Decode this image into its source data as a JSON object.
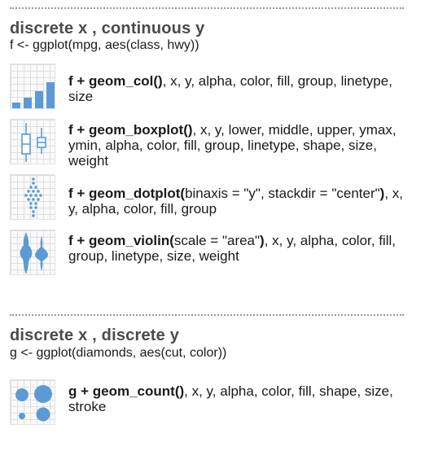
{
  "section1": {
    "title": "discrete x , continuous y",
    "code": "f <- ggplot(mpg, aes(class, hwy))",
    "rows": [
      {
        "icon": "bar-chart-icon",
        "fn": "f + geom_col()",
        "args": ", x, y, alpha, color, fill, group, linetype, size"
      },
      {
        "icon": "boxplot-icon",
        "fn": "f + geom_boxplot()",
        "args": ", x, y, lower, middle, upper, ymax, ymin, alpha, color, fill, group, linetype, shape, size, weight"
      },
      {
        "icon": "dotplot-icon",
        "fn": "f + geom_dotplot(",
        "mid": "binaxis = \"y\", stackdir = \"center\"",
        "fn_close": ")",
        "args": ", x, y, alpha, color, fill, group"
      },
      {
        "icon": "violin-icon",
        "fn": "f + geom_violin(",
        "mid": "scale = \"area\"",
        "fn_close": ")",
        "args": ", x, y, alpha, color, fill, group, linetype, size, weight"
      }
    ]
  },
  "section2": {
    "title": "discrete x , discrete y",
    "code": "g <- ggplot(diamonds, aes(cut, color))",
    "rows": [
      {
        "icon": "count-icon",
        "fn": "g + geom_count()",
        "args": ", x, y, alpha, color, fill, shape, size, stroke"
      }
    ]
  },
  "colors": {
    "accent": "#5b9bd5",
    "title": "#4a4a4a"
  }
}
